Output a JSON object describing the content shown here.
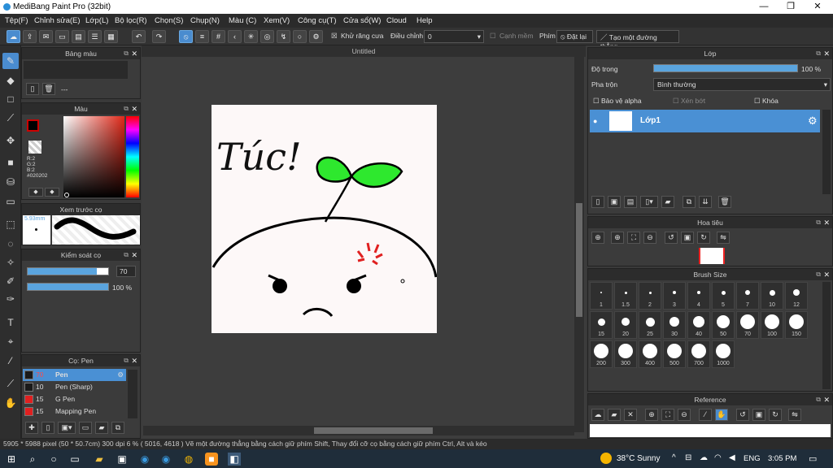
{
  "window": {
    "title": "MediBang Paint Pro (32bit)",
    "minimize": "—",
    "maximize": "❐",
    "close": "✕"
  },
  "menu": [
    "Tệp(F)",
    "Chỉnh sửa(E)",
    "Lớp(L)",
    "Bộ lọc(R)",
    "Chọn(S)",
    "Chụp(N)",
    "Màu (C)",
    "Xem(V)",
    "Công cụ(T)",
    "Cửa sổ(W)",
    "Cloud",
    "Help"
  ],
  "toolbar": {
    "antialias_label": "Khử răng cưa",
    "adjust_label": "Điều chỉnh",
    "adjust_value": "0",
    "smooth_label": "Cạnh mềm",
    "key_label": "Phím",
    "reset_label": "Đặt lại",
    "straight_label": "Tạo một đường thẳng"
  },
  "panels": {
    "palette_title": "Bảng màu",
    "palette_count": "---",
    "color_title": "Màu",
    "rgb": {
      "r": "R:2",
      "g": "G:2",
      "b": "B:2",
      "hex": "#020202"
    },
    "preview_title": "Xem trước cọ",
    "preview_size": "5.93mm",
    "brush_ctrl_title": "Kiểm soát cọ",
    "ctrl_size": "70",
    "ctrl_opacity": "100 %",
    "brush_title": "Cọ: Pen"
  },
  "brushes": [
    {
      "size": "70",
      "name": "Pen",
      "color": "#1a1a1a",
      "selected": true
    },
    {
      "size": "10",
      "name": "Pen (Sharp)",
      "color": "#1a1a1a",
      "selected": false
    },
    {
      "size": "15",
      "name": "G Pen",
      "color": "#e02020",
      "selected": false
    },
    {
      "size": "15",
      "name": "Mapping Pen",
      "color": "#e02020",
      "selected": false
    }
  ],
  "canvas": {
    "tab_title": "Untitled",
    "drawing_text": "Túc!"
  },
  "layer": {
    "title": "Lớp",
    "opacity_label": "Độ trong",
    "opacity_value": "100 %",
    "opacity": 1.0,
    "blend_label": "Pha trộn",
    "blend_value": "Bình thường",
    "alpha_label": "Bảo vệ alpha",
    "clip_label": "Xén bớt",
    "lock_label": "Khóa",
    "layer_name": "Lớp1"
  },
  "navigator": {
    "title": "Hoa tiêu"
  },
  "brush_size": {
    "title": "Brush Size",
    "sizes": [
      "1",
      "1.5",
      "2",
      "3",
      "4",
      "5",
      "7",
      "10",
      "12",
      "15",
      "20",
      "25",
      "30",
      "40",
      "50",
      "70",
      "100",
      "150",
      "200",
      "300",
      "400",
      "500",
      "700",
      "1000"
    ]
  },
  "reference": {
    "title": "Reference"
  },
  "status": "5905 * 5988 pixel  (50 * 50.7cm)  300 dpi  6 %  ( 5016, 4618 )  Vẽ một đường thẳng bằng cách giữ phím Shift, Thay đổi cỡ cọ bằng cách giữ phím Ctrl, Alt và kéo",
  "taskbar": {
    "weather": "38°C  Sunny",
    "lang": "ENG",
    "time": "3:05 PM"
  }
}
